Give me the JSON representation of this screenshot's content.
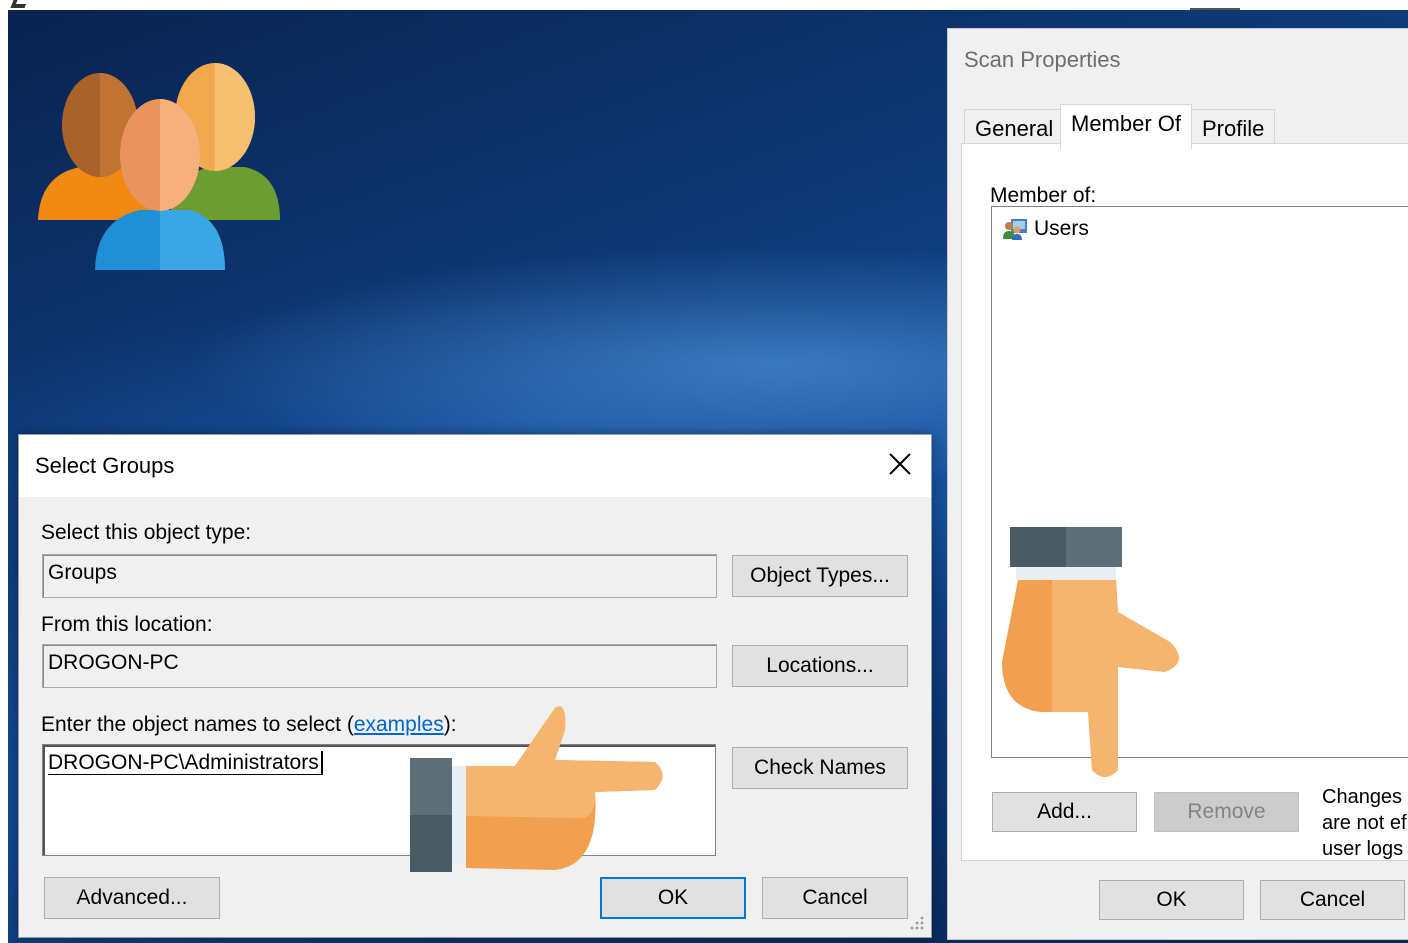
{
  "scan_properties": {
    "title": "Scan Properties",
    "tabs": [
      {
        "label": "General",
        "active": false
      },
      {
        "label": "Member Of",
        "active": true
      },
      {
        "label": "Profile",
        "active": false
      }
    ],
    "member_of_label": "Member of:",
    "groups": [
      {
        "name": "Users",
        "icon": "group-icon"
      }
    ],
    "add_button": "Add...",
    "remove_button": "Remove",
    "changes_note": "Changes\nare not ef\nuser logs",
    "ok_button": "OK",
    "cancel_button": "Cancel"
  },
  "select_groups": {
    "title": "Select Groups",
    "object_type_label": "Select this object type:",
    "object_type_value": "Groups",
    "object_types_button": "Object Types...",
    "location_label": "From this location:",
    "location_value": "DROGON-PC",
    "locations_button": "Locations...",
    "names_label_prefix": "Enter the object names to select (",
    "names_label_link": "examples",
    "names_label_suffix": "):",
    "names_value": "DROGON-PC\\Administrators",
    "check_names_button": "Check Names",
    "advanced_button": "Advanced...",
    "ok_button": "OK",
    "cancel_button": "Cancel"
  },
  "colors": {
    "accent": "#0078d7",
    "dialog_bg": "#f0f0f0",
    "link": "#0066cc",
    "hand_skin": "#f5b26f",
    "sleeve": "#4a5a64"
  }
}
